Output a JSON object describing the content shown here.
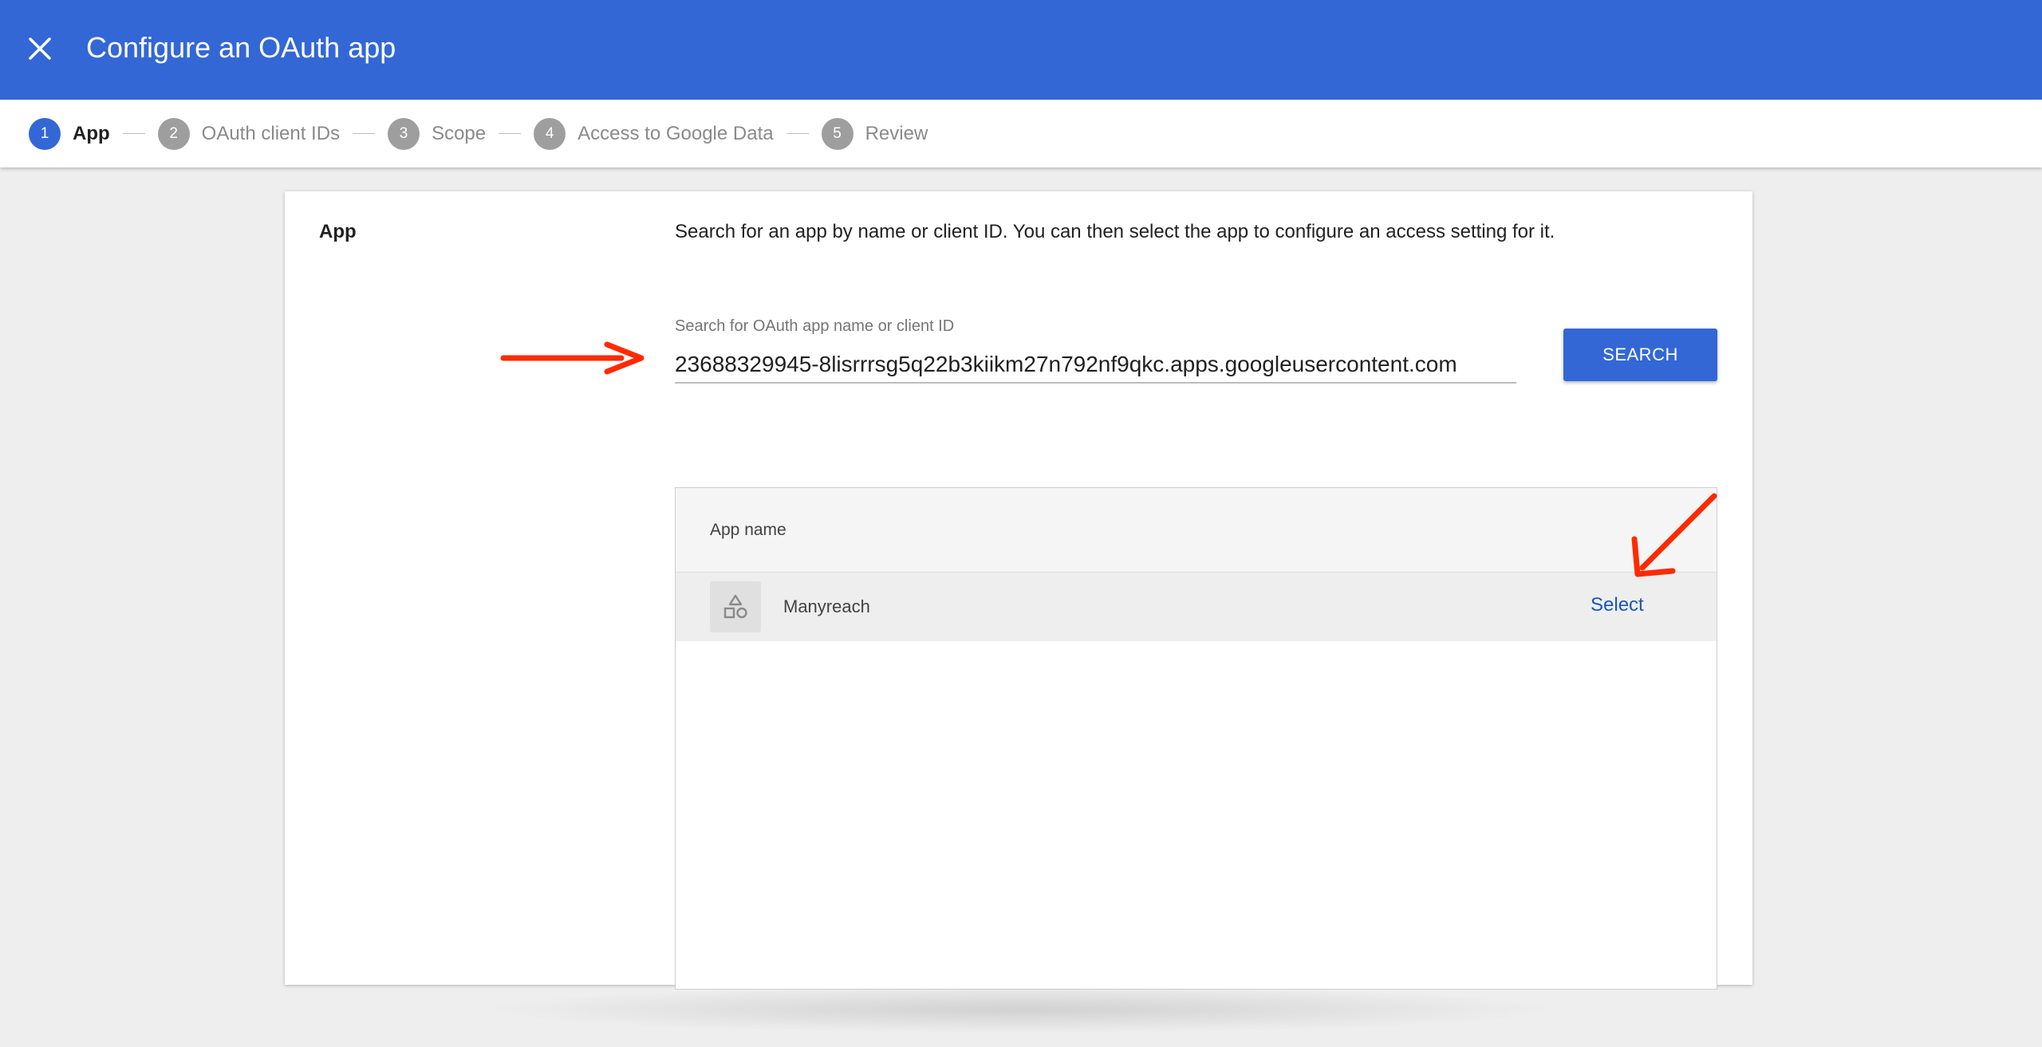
{
  "header": {
    "title": "Configure an OAuth app",
    "close_icon": "close-icon"
  },
  "stepper": {
    "steps": [
      {
        "number": "1",
        "label": "App",
        "active": true
      },
      {
        "number": "2",
        "label": "OAuth client IDs",
        "active": false
      },
      {
        "number": "3",
        "label": "Scope",
        "active": false
      },
      {
        "number": "4",
        "label": "Access to Google Data",
        "active": false
      },
      {
        "number": "5",
        "label": "Review",
        "active": false
      }
    ]
  },
  "section": {
    "title": "App",
    "description": "Search for an app by name or client ID. You can then select the app to configure an access setting for it."
  },
  "search": {
    "label": "Search for OAuth app name or client ID",
    "value": "23688329945-8lisrrrsg5q22b3kiikm27n792nf9qkc.apps.googleusercontent.com",
    "button_label": "SEARCH"
  },
  "table": {
    "header": "App name",
    "rows": [
      {
        "name": "Manyreach",
        "icon": "shapes-icon",
        "action": "Select"
      }
    ]
  },
  "colors": {
    "brand": "#3367d6",
    "link": "#1a57b8",
    "annotation": "#ff2a00"
  }
}
